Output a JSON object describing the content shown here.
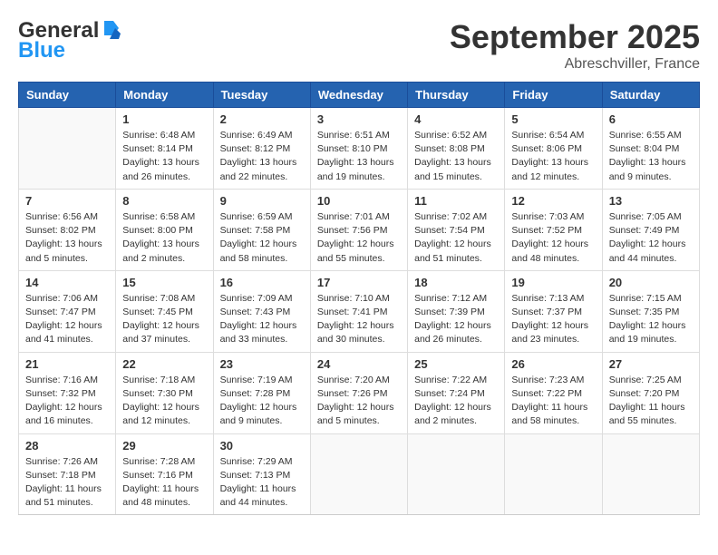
{
  "logo": {
    "line1": "General",
    "line2": "Blue"
  },
  "title": "September 2025",
  "location": "Abreschviller, France",
  "days_of_week": [
    "Sunday",
    "Monday",
    "Tuesday",
    "Wednesday",
    "Thursday",
    "Friday",
    "Saturday"
  ],
  "weeks": [
    [
      {
        "day": "",
        "info": ""
      },
      {
        "day": "1",
        "info": "Sunrise: 6:48 AM\nSunset: 8:14 PM\nDaylight: 13 hours\nand 26 minutes."
      },
      {
        "day": "2",
        "info": "Sunrise: 6:49 AM\nSunset: 8:12 PM\nDaylight: 13 hours\nand 22 minutes."
      },
      {
        "day": "3",
        "info": "Sunrise: 6:51 AM\nSunset: 8:10 PM\nDaylight: 13 hours\nand 19 minutes."
      },
      {
        "day": "4",
        "info": "Sunrise: 6:52 AM\nSunset: 8:08 PM\nDaylight: 13 hours\nand 15 minutes."
      },
      {
        "day": "5",
        "info": "Sunrise: 6:54 AM\nSunset: 8:06 PM\nDaylight: 13 hours\nand 12 minutes."
      },
      {
        "day": "6",
        "info": "Sunrise: 6:55 AM\nSunset: 8:04 PM\nDaylight: 13 hours\nand 9 minutes."
      }
    ],
    [
      {
        "day": "7",
        "info": "Sunrise: 6:56 AM\nSunset: 8:02 PM\nDaylight: 13 hours\nand 5 minutes."
      },
      {
        "day": "8",
        "info": "Sunrise: 6:58 AM\nSunset: 8:00 PM\nDaylight: 13 hours\nand 2 minutes."
      },
      {
        "day": "9",
        "info": "Sunrise: 6:59 AM\nSunset: 7:58 PM\nDaylight: 12 hours\nand 58 minutes."
      },
      {
        "day": "10",
        "info": "Sunrise: 7:01 AM\nSunset: 7:56 PM\nDaylight: 12 hours\nand 55 minutes."
      },
      {
        "day": "11",
        "info": "Sunrise: 7:02 AM\nSunset: 7:54 PM\nDaylight: 12 hours\nand 51 minutes."
      },
      {
        "day": "12",
        "info": "Sunrise: 7:03 AM\nSunset: 7:52 PM\nDaylight: 12 hours\nand 48 minutes."
      },
      {
        "day": "13",
        "info": "Sunrise: 7:05 AM\nSunset: 7:49 PM\nDaylight: 12 hours\nand 44 minutes."
      }
    ],
    [
      {
        "day": "14",
        "info": "Sunrise: 7:06 AM\nSunset: 7:47 PM\nDaylight: 12 hours\nand 41 minutes."
      },
      {
        "day": "15",
        "info": "Sunrise: 7:08 AM\nSunset: 7:45 PM\nDaylight: 12 hours\nand 37 minutes."
      },
      {
        "day": "16",
        "info": "Sunrise: 7:09 AM\nSunset: 7:43 PM\nDaylight: 12 hours\nand 33 minutes."
      },
      {
        "day": "17",
        "info": "Sunrise: 7:10 AM\nSunset: 7:41 PM\nDaylight: 12 hours\nand 30 minutes."
      },
      {
        "day": "18",
        "info": "Sunrise: 7:12 AM\nSunset: 7:39 PM\nDaylight: 12 hours\nand 26 minutes."
      },
      {
        "day": "19",
        "info": "Sunrise: 7:13 AM\nSunset: 7:37 PM\nDaylight: 12 hours\nand 23 minutes."
      },
      {
        "day": "20",
        "info": "Sunrise: 7:15 AM\nSunset: 7:35 PM\nDaylight: 12 hours\nand 19 minutes."
      }
    ],
    [
      {
        "day": "21",
        "info": "Sunrise: 7:16 AM\nSunset: 7:32 PM\nDaylight: 12 hours\nand 16 minutes."
      },
      {
        "day": "22",
        "info": "Sunrise: 7:18 AM\nSunset: 7:30 PM\nDaylight: 12 hours\nand 12 minutes."
      },
      {
        "day": "23",
        "info": "Sunrise: 7:19 AM\nSunset: 7:28 PM\nDaylight: 12 hours\nand 9 minutes."
      },
      {
        "day": "24",
        "info": "Sunrise: 7:20 AM\nSunset: 7:26 PM\nDaylight: 12 hours\nand 5 minutes."
      },
      {
        "day": "25",
        "info": "Sunrise: 7:22 AM\nSunset: 7:24 PM\nDaylight: 12 hours\nand 2 minutes."
      },
      {
        "day": "26",
        "info": "Sunrise: 7:23 AM\nSunset: 7:22 PM\nDaylight: 11 hours\nand 58 minutes."
      },
      {
        "day": "27",
        "info": "Sunrise: 7:25 AM\nSunset: 7:20 PM\nDaylight: 11 hours\nand 55 minutes."
      }
    ],
    [
      {
        "day": "28",
        "info": "Sunrise: 7:26 AM\nSunset: 7:18 PM\nDaylight: 11 hours\nand 51 minutes."
      },
      {
        "day": "29",
        "info": "Sunrise: 7:28 AM\nSunset: 7:16 PM\nDaylight: 11 hours\nand 48 minutes."
      },
      {
        "day": "30",
        "info": "Sunrise: 7:29 AM\nSunset: 7:13 PM\nDaylight: 11 hours\nand 44 minutes."
      },
      {
        "day": "",
        "info": ""
      },
      {
        "day": "",
        "info": ""
      },
      {
        "day": "",
        "info": ""
      },
      {
        "day": "",
        "info": ""
      }
    ]
  ]
}
